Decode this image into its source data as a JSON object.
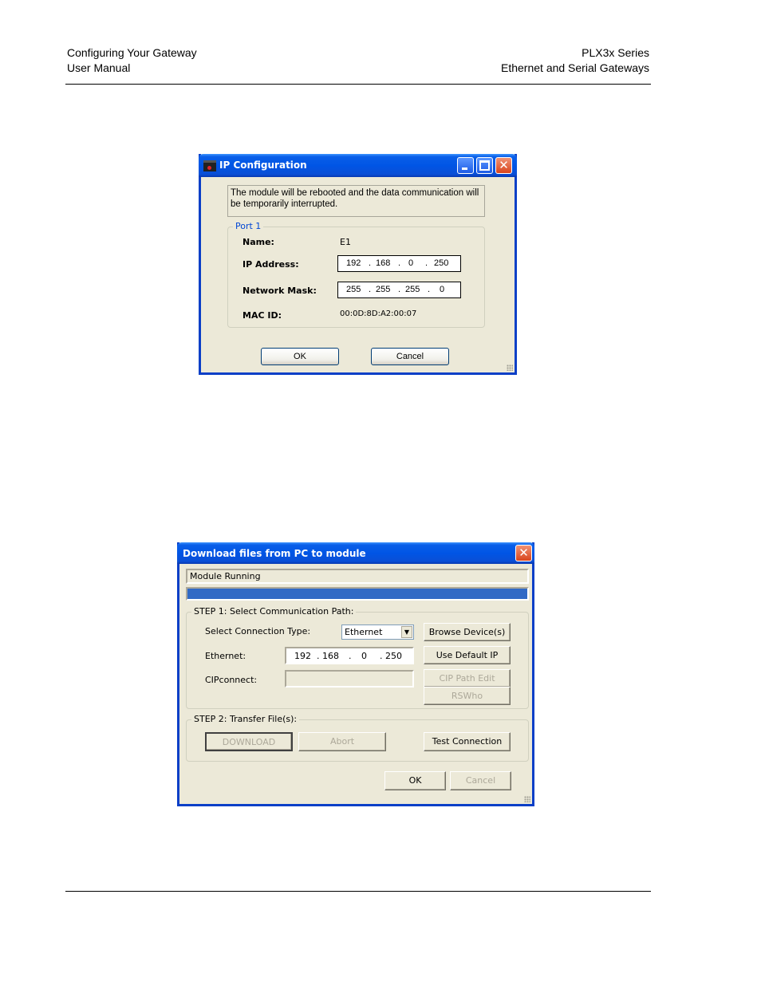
{
  "header": {
    "left_line1": "Configuring Your Gateway",
    "left_line2": "User Manual",
    "right_line1": "PLX3x Series",
    "right_line2": "Ethernet and Serial Gateways"
  },
  "ip_dialog": {
    "title": "IP Configuration",
    "message": "The module will be rebooted and the data communication will be temporarily interrupted.",
    "group_label": "Port 1",
    "name_label": "Name:",
    "name_value": "E1",
    "ip_label": "IP Address:",
    "ip_octets": [
      "192",
      "168",
      "0",
      "250"
    ],
    "mask_label": "Network Mask:",
    "mask_octets": [
      "255",
      "255",
      "255",
      "0"
    ],
    "mac_label": "MAC ID:",
    "mac_value": "00:0D:8D:A2:00:07",
    "ok_label": "OK",
    "cancel_label": "Cancel"
  },
  "download_dialog": {
    "title": "Download files from PC to module",
    "status_text": "Module Running",
    "progress_fraction": 1.0,
    "progress_color": "#316ac5",
    "step1_label": "STEP 1: Select Communication Path:",
    "connection_type_label": "Select Connection Type:",
    "connection_type_value": "Ethernet",
    "browse_label": "Browse Device(s)",
    "ethernet_label": "Ethernet:",
    "ethernet_octets": [
      "192",
      "168",
      "0",
      "250"
    ],
    "default_ip_label": "Use Default IP",
    "cipconnect_label": "CIPconnect:",
    "cipconnect_value": "",
    "cip_path_label": "CIP Path Edit",
    "rswho_label": "RSWho",
    "step2_label": "STEP 2: Transfer File(s):",
    "download_label": "DOWNLOAD",
    "abort_label": "Abort",
    "test_label": "Test Connection",
    "ok_label": "OK",
    "cancel_label": "Cancel"
  }
}
